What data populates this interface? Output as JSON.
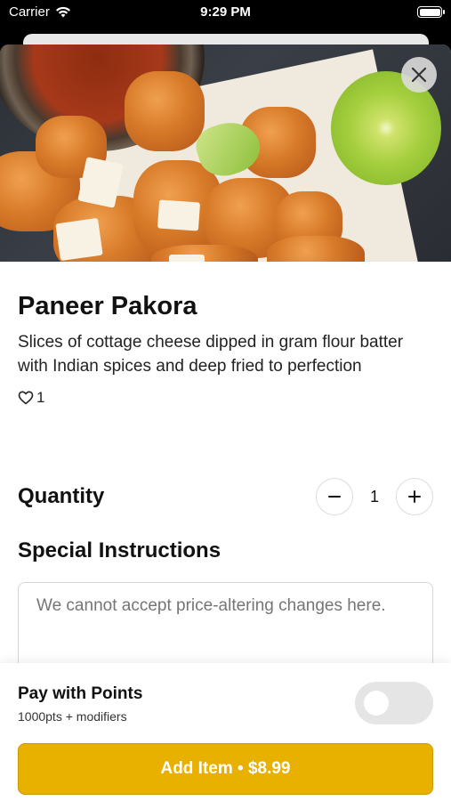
{
  "status_bar": {
    "carrier": "Carrier",
    "time": "9:29 PM"
  },
  "item": {
    "title": "Paneer Pakora",
    "description": "Slices of cottage cheese dipped in gram flour batter with Indian spices and deep fried to perfection",
    "likes": "1"
  },
  "quantity": {
    "label": "Quantity",
    "value": "1"
  },
  "instructions": {
    "label": "Special Instructions",
    "placeholder": "We cannot accept price-altering changes here."
  },
  "points": {
    "title": "Pay with Points",
    "subtitle": "1000pts + modifiers",
    "enabled": false
  },
  "add_button": {
    "label": "Add Item • $8.99"
  },
  "colors": {
    "accent": "#e8b100",
    "toggle_off": "#e5e5e5"
  },
  "icons": {
    "close": "close-icon",
    "heart": "heart-icon",
    "minus": "minus-icon",
    "plus": "plus-icon",
    "wifi": "wifi-icon",
    "battery": "battery-icon"
  }
}
